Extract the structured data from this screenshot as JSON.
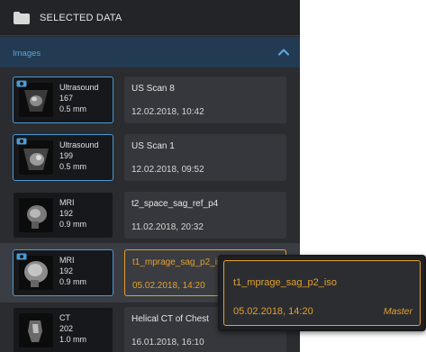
{
  "header": {
    "title": "SELECTED DATA",
    "icon": "folder-icon"
  },
  "section": {
    "title": "Images",
    "icon": "chevron-up-icon"
  },
  "colors": {
    "accent_blue": "#4a9bd6",
    "accent_orange": "#e4a12e",
    "panel_bg": "#2a2c30"
  },
  "items": [
    {
      "modality": "Ultrasound",
      "count": "167",
      "thickness": "0.5 mm",
      "name": "US Scan 8",
      "date": "12.02.2018, 10:42"
    },
    {
      "modality": "Ultrasound",
      "count": "199",
      "thickness": "0.5 mm",
      "name": "US Scan 1",
      "date": "12.02.2018, 09:52"
    },
    {
      "modality": "MRI",
      "count": "192",
      "thickness": "0.9 mm",
      "name": "t2_space_sag_ref_p4",
      "date": "11.02.2018, 20:32"
    },
    {
      "modality": "MRI",
      "count": "192",
      "thickness": "0.9 mm",
      "name": "t1_mprage_sag_p2_iso",
      "date": "05.02.2018, 14:20"
    },
    {
      "modality": "CT",
      "count": "202",
      "thickness": "1.0 mm",
      "name": "Helical CT of Chest",
      "date": "16.01.2018, 16:10"
    }
  ],
  "tooltip": {
    "name": "t1_mprage_sag_p2_iso",
    "date": "05.02.2018, 14:20",
    "badge": "Master"
  }
}
